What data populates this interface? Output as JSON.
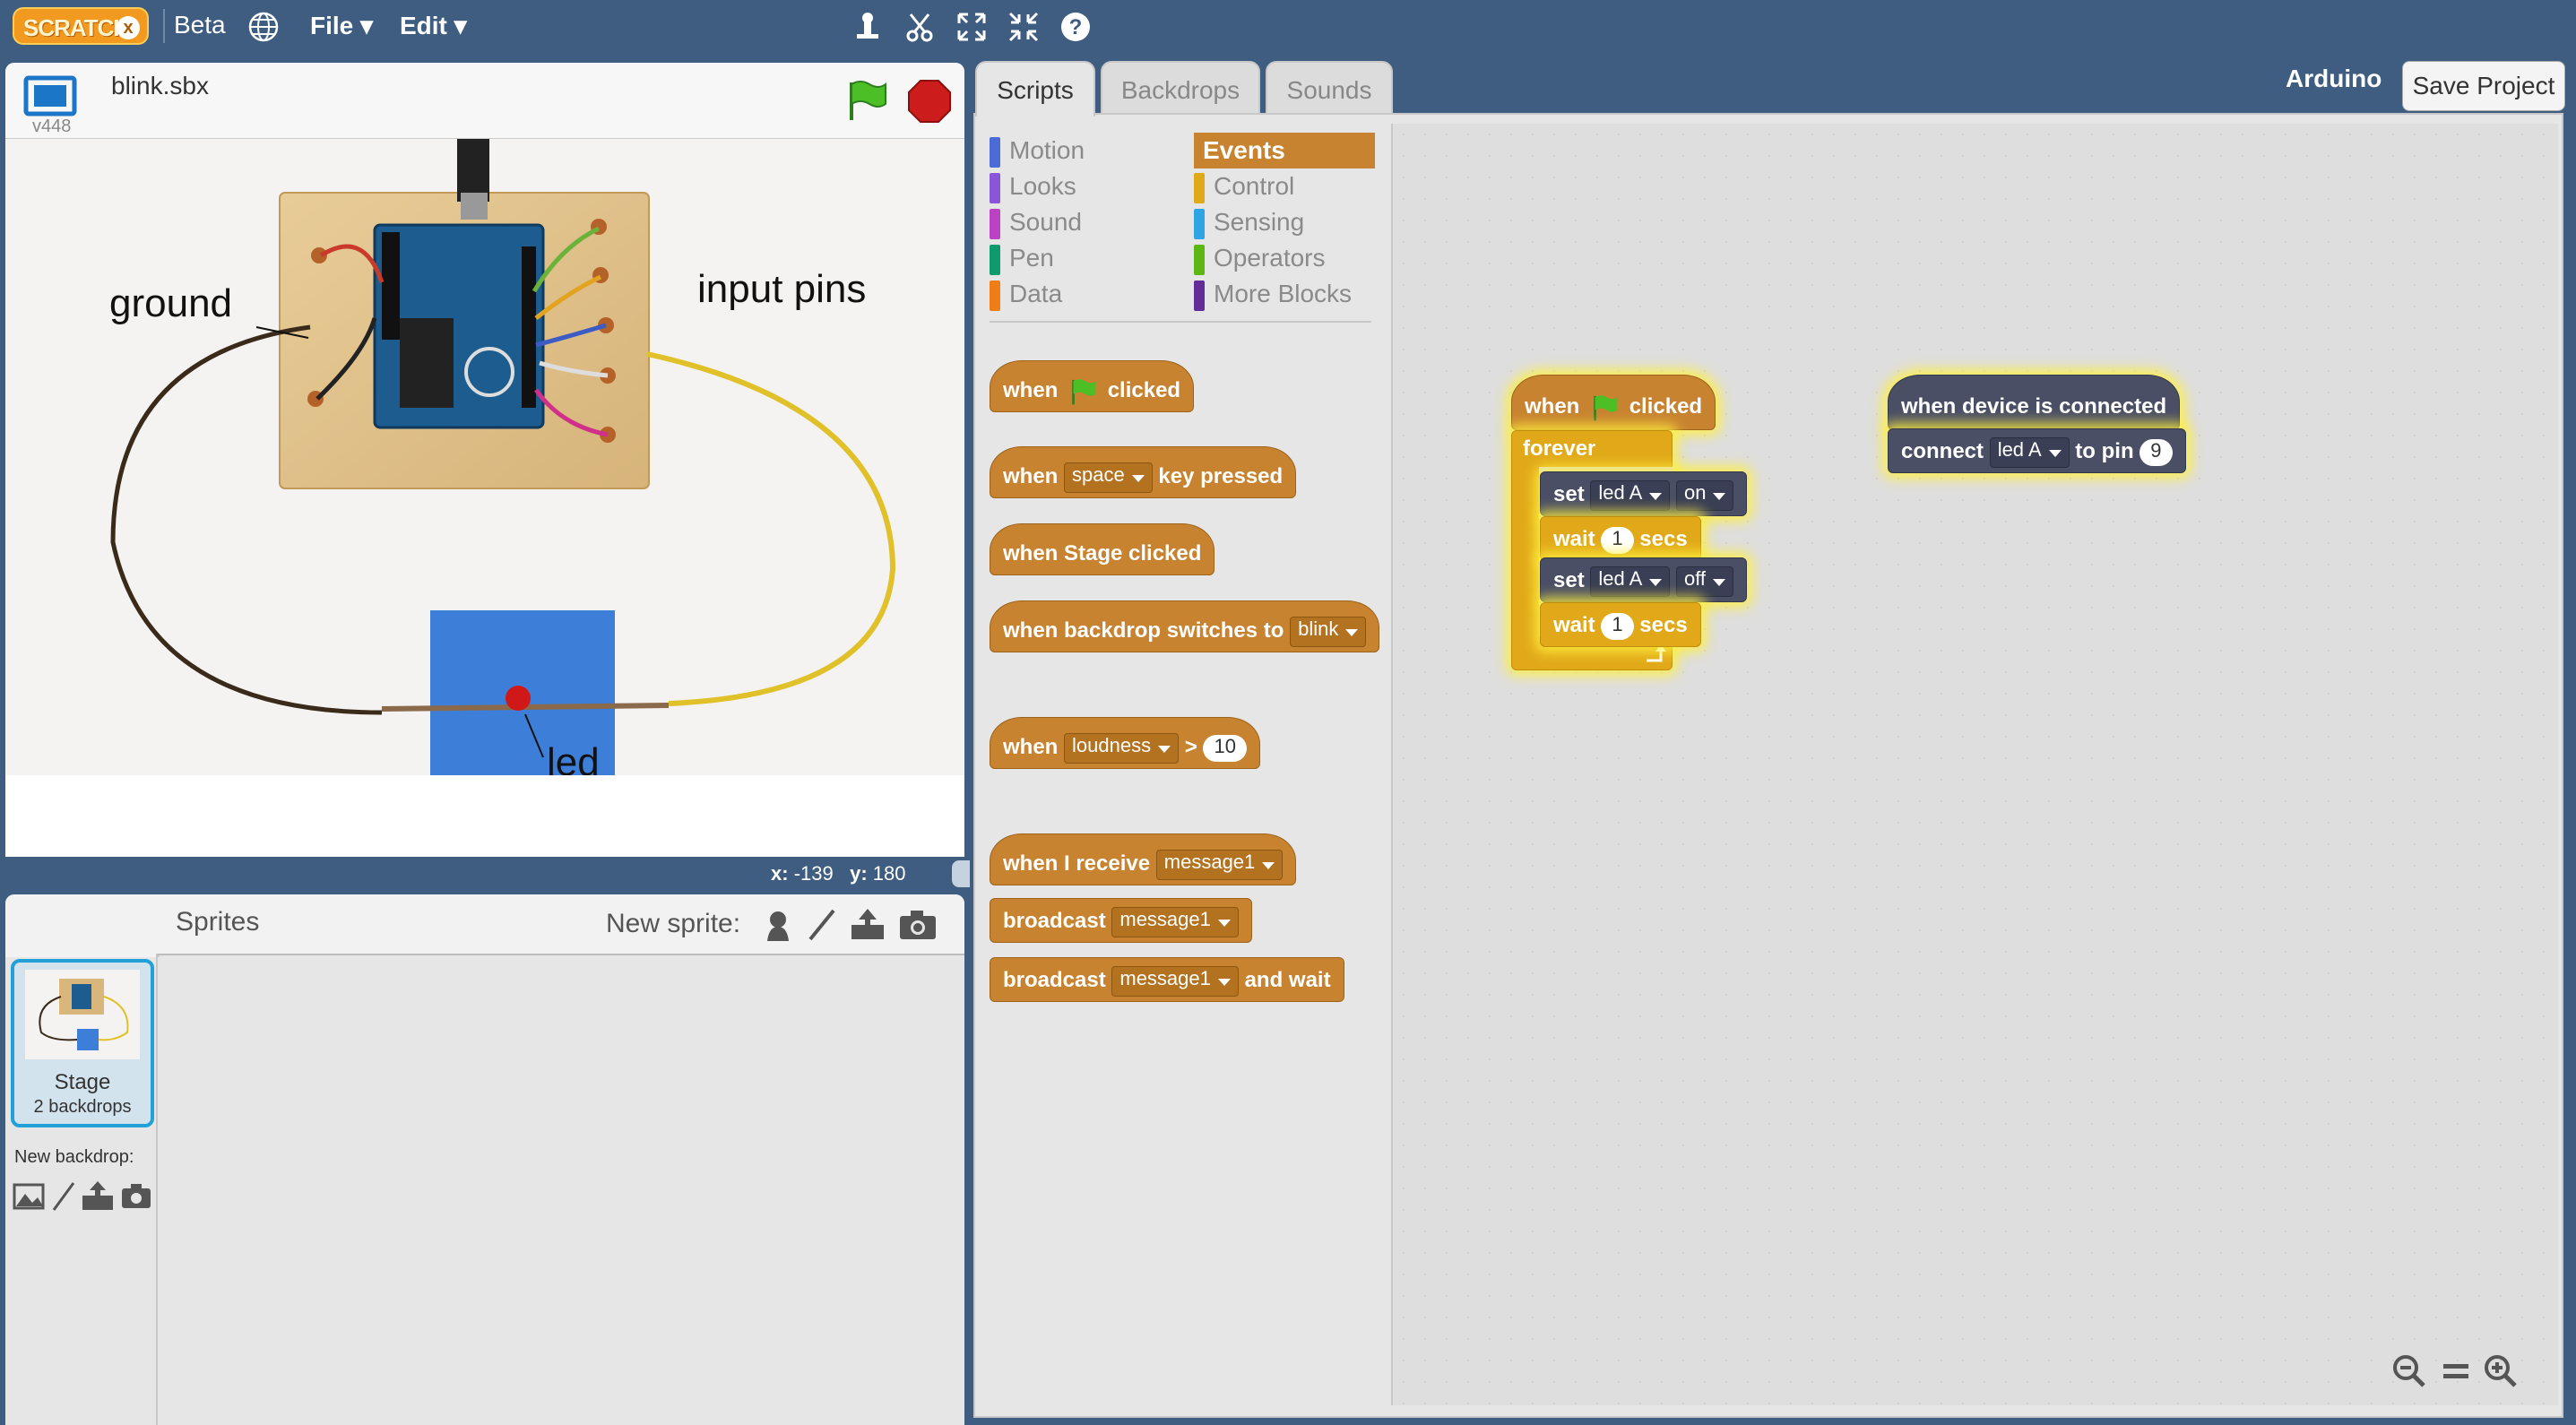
{
  "menu": {
    "logo_text": "SCRATCH",
    "logo_badge": "x",
    "beta": "Beta",
    "file": "File",
    "edit": "Edit",
    "icons": [
      "globe-icon",
      "duplicate-stamp-icon",
      "delete-cut-icon",
      "grow-icon",
      "shrink-icon",
      "help-icon"
    ]
  },
  "stage": {
    "project_name": "blink.sbx",
    "version": "v448",
    "coords": {
      "x_label": "x:",
      "x_value": "-139",
      "y_label": "y:",
      "y_value": "180"
    },
    "photo_labels": {
      "ground": "ground",
      "input_pins": "input pins",
      "led": "led"
    }
  },
  "sprites": {
    "title": "Sprites",
    "new_sprite": "New sprite:",
    "stage_label": "Stage",
    "stage_backdrops": "2 backdrops",
    "new_backdrop": "New backdrop:"
  },
  "scripts": {
    "tabs": [
      "Scripts",
      "Backdrops",
      "Sounds"
    ],
    "extension": "Arduino",
    "save": "Save Project",
    "categories_left": [
      {
        "label": "Motion",
        "color": "#4a6cd4"
      },
      {
        "label": "Looks",
        "color": "#8a55d7"
      },
      {
        "label": "Sound",
        "color": "#bb42c3"
      },
      {
        "label": "Pen",
        "color": "#0e9a6c"
      },
      {
        "label": "Data",
        "color": "#ee7d16"
      }
    ],
    "categories_right": [
      {
        "label": "Events",
        "color": "#c88330"
      },
      {
        "label": "Control",
        "color": "#e1a91a"
      },
      {
        "label": "Sensing",
        "color": "#2ca5e2"
      },
      {
        "label": "Operators",
        "color": "#5cb712"
      },
      {
        "label": "More Blocks",
        "color": "#632d99"
      }
    ],
    "palette": {
      "flag": {
        "when": "when",
        "clicked": "clicked"
      },
      "key": {
        "when": "when",
        "key": "space",
        "pressed": "key pressed"
      },
      "stage": "when Stage clicked",
      "backdrop": {
        "text": "when backdrop switches to",
        "value": "blink"
      },
      "loudness": {
        "when": "when",
        "sensor": "loudness",
        "op": ">",
        "value": "10"
      },
      "receive": {
        "text": "when I receive",
        "value": "message1"
      },
      "broadcast": {
        "text": "broadcast",
        "value": "message1"
      },
      "broadcast_wait": {
        "text": "broadcast",
        "value": "message1",
        "suffix": "and wait"
      }
    },
    "canvas": {
      "script1": {
        "hat_when": "when",
        "hat_clicked": "clicked",
        "forever": "forever",
        "set1": {
          "label": "set",
          "device": "led A",
          "state": "on"
        },
        "wait1": {
          "label": "wait",
          "value": "1",
          "unit": "secs"
        },
        "set2": {
          "label": "set",
          "device": "led A",
          "state": "off"
        },
        "wait2": {
          "label": "wait",
          "value": "1",
          "unit": "secs"
        }
      },
      "script2": {
        "hat": "when device is connected",
        "connect": "connect",
        "device": "led A",
        "to_pin": "to pin",
        "pin": "9"
      }
    }
  }
}
